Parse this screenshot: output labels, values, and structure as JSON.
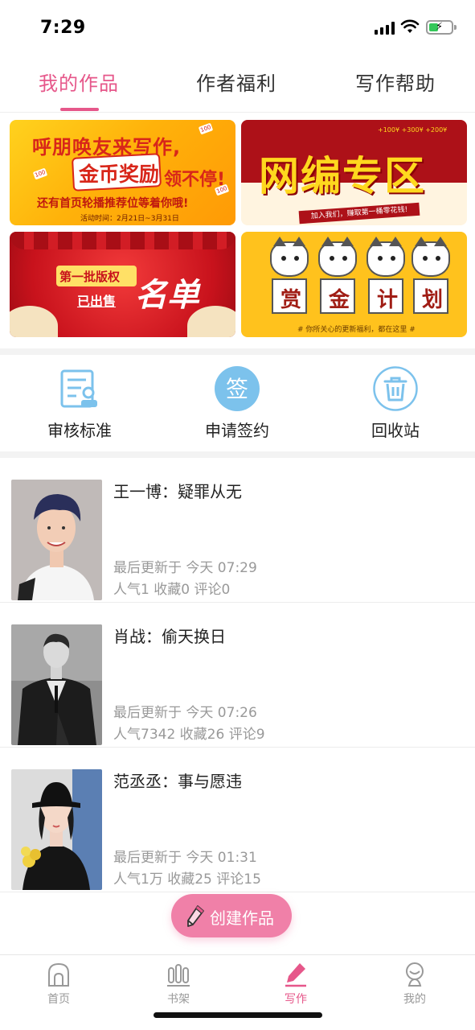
{
  "status_bar": {
    "time": "7:29"
  },
  "tabs": [
    {
      "label": "我的作品",
      "active": true
    },
    {
      "label": "作者福利",
      "active": false
    },
    {
      "label": "写作帮助",
      "active": false
    }
  ],
  "banners": {
    "b1": {
      "line1": "呼朋唤友来写作,",
      "line2": "金币奖励",
      "line2b": "领不停!",
      "line3": "还有首页轮播推荐位等着你哦!",
      "line4": "活动时间：2月21日~3月31日",
      "coin": "100"
    },
    "b2": {
      "title": "网编专区",
      "sub": "加入我们，赚取第一桶零花钱!",
      "money": "+100¥ +300¥ +200¥"
    },
    "b3": {
      "t1": "第一批版权",
      "t2": "已出售",
      "t3": "名单"
    },
    "b4": {
      "chars": [
        "赏",
        "金",
        "计",
        "划"
      ],
      "foot": "# 你所关心的更新福利，都在这里 #"
    }
  },
  "quick_actions": [
    {
      "label": "审核标准",
      "icon": "review-standard-icon"
    },
    {
      "label": "申请签约",
      "icon": "sign-contract-icon",
      "glyph": "签"
    },
    {
      "label": "回收站",
      "icon": "trash-icon"
    }
  ],
  "works": [
    {
      "title": "王一博：疑罪从无",
      "updated": "最后更新于 今天 07:29",
      "stats": "人气1 收藏0 评论0"
    },
    {
      "title": "肖战：偷天换日",
      "updated": "最后更新于 今天 07:26",
      "stats": "人气7342 收藏26 评论9"
    },
    {
      "title": "范丞丞：事与愿违",
      "updated": "最后更新于 今天 01:31",
      "stats": "人气1万 收藏25 评论15"
    }
  ],
  "fab": {
    "label": "创建作品",
    "icon": "pencil-icon"
  },
  "bottom_nav": [
    {
      "label": "首页",
      "icon": "home-icon"
    },
    {
      "label": "书架",
      "icon": "bookshelf-icon"
    },
    {
      "label": "写作",
      "icon": "write-icon",
      "active": true
    },
    {
      "label": "我的",
      "icon": "profile-icon"
    }
  ],
  "colors": {
    "accent": "#e6578a",
    "fab": "#f080a8",
    "icon_blue": "#7cc2ec"
  }
}
